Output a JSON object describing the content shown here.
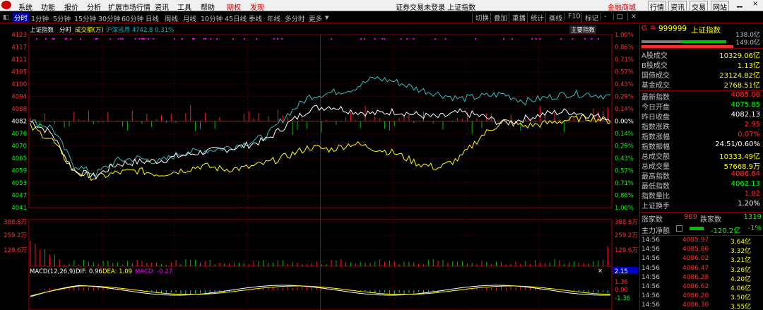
{
  "menu": {
    "items": [
      "系统",
      "功能",
      "报价",
      "分析",
      "扩展市场行情",
      "资讯",
      "工具",
      "帮助",
      "期权",
      "发现"
    ],
    "center_title": "证券交易未登录 上证指数",
    "right": [
      "金融商城",
      "行情",
      "资讯",
      "交易",
      "网站"
    ]
  },
  "tabs": {
    "items": [
      "分时",
      "1分钟",
      "5分钟",
      "15分钟",
      "30分钟",
      "60分钟",
      "日线",
      "周线",
      "月线",
      "10分钟",
      "45日线",
      "季线",
      "年线",
      "多分时",
      "更多"
    ],
    "selected": "分时",
    "right_buttons": [
      "切换",
      "叠加",
      "重播",
      "统计",
      "画线",
      "F10",
      "标记",
      "-",
      "□",
      "×"
    ]
  },
  "chart": {
    "header": {
      "name": "上证指数",
      "mode": "分时",
      "vol_label": "成交额(万)",
      "sh_sz": "沪深当月 4742.8 0.31%"
    },
    "main_index_btn": "主要指数",
    "y_labels": [
      "4123",
      "4117",
      "4111",
      "4105",
      "4100",
      "4094",
      "4088",
      "4082",
      "4076",
      "4070",
      "4065",
      "4059",
      "4053",
      "4047",
      "4041"
    ],
    "pct_labels": [
      "1.00%",
      "0.86%",
      "0.71%",
      "0.57%",
      "0.43%",
      "0.29%",
      "0.14%",
      "0.00%",
      "0.14%",
      "0.29%",
      "0.43%",
      "0.57%",
      "0.71%",
      "0.86%",
      "1.00%"
    ],
    "vol_labels": [
      "388.8万",
      "259.2万",
      "129.6万"
    ],
    "macd": {
      "label": "MACD(12,26,9)",
      "dif": "DIF: 0.96",
      "dea": "DEA: 1.09",
      "macd": "MACD: -0.27"
    },
    "macd_axis": [
      "2.15",
      "1.36",
      "0.00",
      "-1.36"
    ]
  },
  "side": {
    "code": "999999",
    "name": "上证指数",
    "prefix": "G",
    "bar1": "138.0亿",
    "bar2": "149.0亿",
    "block1": [
      [
        "A股成交",
        "10329.06亿",
        "#ffff00"
      ],
      [
        "B股成交",
        "1.13亿",
        "#ffff00"
      ],
      [
        "国债成交",
        "23124.82亿",
        "#ffff00"
      ],
      [
        "基金成交",
        "2768.51亿",
        "#ffff00"
      ]
    ],
    "block2": [
      [
        "最新指数",
        "4085.08",
        "#ff3030"
      ],
      [
        "今日开盘",
        "4075.85",
        "#00ff00"
      ],
      [
        "昨日收盘",
        "4082.13",
        "#ffffff"
      ],
      [
        "指数涨跌",
        "2.95",
        "#ff3030"
      ],
      [
        "指数涨幅",
        "0.07%",
        "#ff3030"
      ],
      [
        "指数振幅",
        "24.51/0.60%",
        "#ffffff"
      ],
      [
        "总成交额",
        "10333.49亿",
        "#ffff00"
      ],
      [
        "总成交量",
        "57668.9万",
        "#ffff00"
      ],
      [
        "最高指数",
        "4086.64",
        "#ff3030"
      ],
      [
        "最低指数",
        "4062.13",
        "#00ff00"
      ],
      [
        "指数量比",
        "1.02",
        "#ff3030"
      ],
      [
        "上证换手",
        "1.20%",
        "#ffffff"
      ]
    ],
    "updown": {
      "up_label": "涨家数",
      "up": "969",
      "down_label": "跌家数",
      "down": "1319"
    },
    "flow": {
      "label": "主力净额",
      "value": "-120.2亿",
      "pct": "-1%"
    },
    "ticks": [
      [
        "14:56",
        "4085.97",
        "3.64亿"
      ],
      [
        "14:56",
        "4085.86",
        "3.32亿"
      ],
      [
        "14:56",
        "4086.02",
        "3.21亿"
      ],
      [
        "14:56",
        "4086.47",
        "3.26亿"
      ],
      [
        "14:56",
        "4086.28",
        "4.20亿"
      ],
      [
        "14:56",
        "4086.62",
        "4.06亿"
      ],
      [
        "14:56",
        "4086.20",
        "3.50亿"
      ],
      [
        "14:56",
        "4086.30",
        "3.55亿"
      ]
    ]
  }
}
